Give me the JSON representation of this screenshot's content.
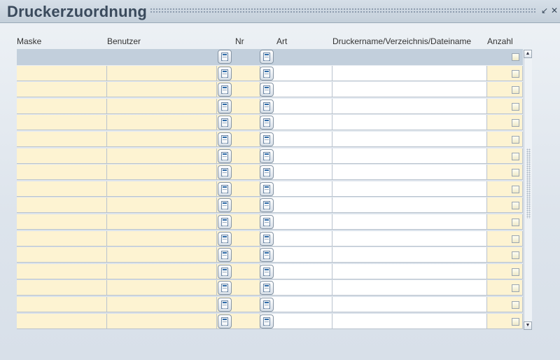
{
  "window": {
    "title": "Druckerzuordnung",
    "minimize_icon": "minimize-icon",
    "close_icon": "close-icon"
  },
  "table": {
    "columns": [
      "Maske",
      "Benutzer",
      "Nr",
      "Art",
      "Druckername/Verzeichnis/Dateiname",
      "Anzahl"
    ],
    "row_count": 17,
    "selected_row": 1,
    "rows": [
      {
        "maske": "",
        "benutzer": "",
        "nr": "",
        "art": "",
        "druckername": "",
        "anzahl": "",
        "checked": false
      },
      {
        "maske": "",
        "benutzer": "",
        "nr": "",
        "art": "",
        "druckername": "",
        "anzahl": "",
        "checked": false
      },
      {
        "maske": "",
        "benutzer": "",
        "nr": "",
        "art": "",
        "druckername": "",
        "anzahl": "",
        "checked": false
      },
      {
        "maske": "",
        "benutzer": "",
        "nr": "",
        "art": "",
        "druckername": "",
        "anzahl": "",
        "checked": false
      },
      {
        "maske": "",
        "benutzer": "",
        "nr": "",
        "art": "",
        "druckername": "",
        "anzahl": "",
        "checked": false
      },
      {
        "maske": "",
        "benutzer": "",
        "nr": "",
        "art": "",
        "druckername": "",
        "anzahl": "",
        "checked": false
      },
      {
        "maske": "",
        "benutzer": "",
        "nr": "",
        "art": "",
        "druckername": "",
        "anzahl": "",
        "checked": false
      },
      {
        "maske": "",
        "benutzer": "",
        "nr": "",
        "art": "",
        "druckername": "",
        "anzahl": "",
        "checked": false
      },
      {
        "maske": "",
        "benutzer": "",
        "nr": "",
        "art": "",
        "druckername": "",
        "anzahl": "",
        "checked": false
      },
      {
        "maske": "",
        "benutzer": "",
        "nr": "",
        "art": "",
        "druckername": "",
        "anzahl": "",
        "checked": false
      },
      {
        "maske": "",
        "benutzer": "",
        "nr": "",
        "art": "",
        "druckername": "",
        "anzahl": "",
        "checked": false
      },
      {
        "maske": "",
        "benutzer": "",
        "nr": "",
        "art": "",
        "druckername": "",
        "anzahl": "",
        "checked": false
      },
      {
        "maske": "",
        "benutzer": "",
        "nr": "",
        "art": "",
        "druckername": "",
        "anzahl": "",
        "checked": false
      },
      {
        "maske": "",
        "benutzer": "",
        "nr": "",
        "art": "",
        "druckername": "",
        "anzahl": "",
        "checked": false
      },
      {
        "maske": "",
        "benutzer": "",
        "nr": "",
        "art": "",
        "druckername": "",
        "anzahl": "",
        "checked": false
      },
      {
        "maske": "",
        "benutzer": "",
        "nr": "",
        "art": "",
        "druckername": "",
        "anzahl": "",
        "checked": false
      },
      {
        "maske": "",
        "benutzer": "",
        "nr": "",
        "art": "",
        "druckername": "",
        "anzahl": "",
        "checked": false
      }
    ]
  },
  "icons": {
    "lov_button": "document-list-icon",
    "scroll_up": "arrow-up-icon",
    "scroll_down": "arrow-down-icon"
  },
  "colors": {
    "editable_cell": "#fdf3d2",
    "text_cell": "#ffffff",
    "selected_row": "#c2cfdc",
    "title": "#3a4a5c"
  }
}
